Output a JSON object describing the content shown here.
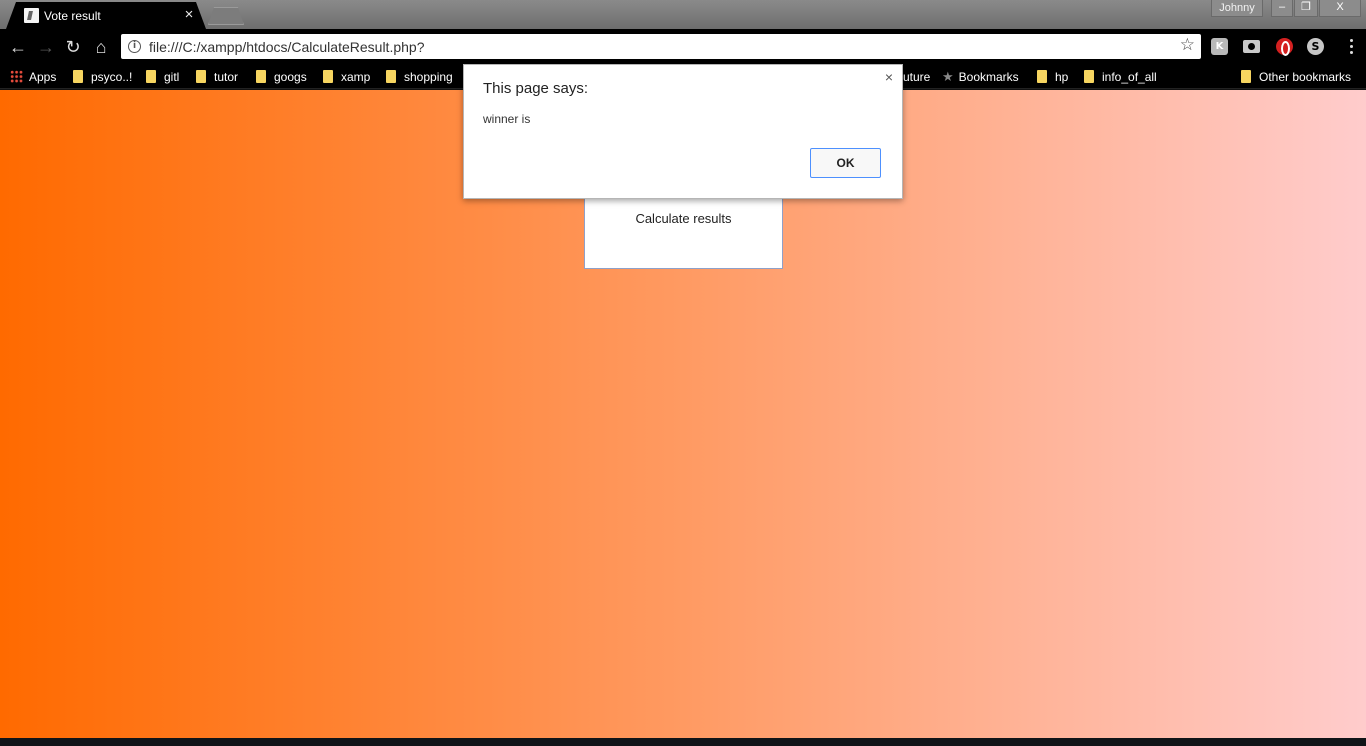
{
  "window": {
    "tab_title": "Vote result",
    "profile_name": "Johnny",
    "minimize_glyph": "–",
    "restore_glyph": "❐",
    "close_glyph": "X"
  },
  "toolbar": {
    "back_icon": "←",
    "forward_icon": "→",
    "reload_icon": "↻",
    "home_icon": "⌂",
    "url": "file:///C:/xampp/htdocs/CalculateResult.php?",
    "bookmark_star": "☆",
    "extensions": [
      "k-extension-icon",
      "camera-icon",
      "opera-icon",
      "skype-icon"
    ]
  },
  "bookmarks": {
    "apps": "Apps",
    "items": [
      "psyco..!",
      "gitl",
      "tutor",
      "googs",
      "xamp",
      "shopping"
    ],
    "partial_item": "uture",
    "star_item": "Bookmarks",
    "items_right": [
      "hp",
      "info_of_all"
    ],
    "other": "Other bookmarks"
  },
  "page": {
    "button_label": "Calculate results",
    "gradient_colors": [
      "#ff6a00",
      "#ffcccc"
    ]
  },
  "dialog": {
    "title": "This page says:",
    "message": "winner is",
    "ok_label": "OK",
    "close_glyph": "×"
  }
}
